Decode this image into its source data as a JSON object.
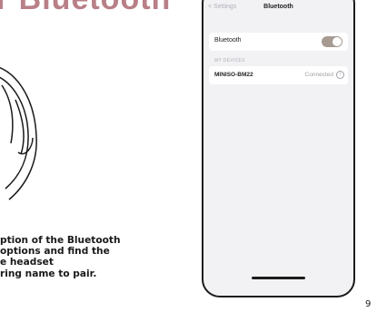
{
  "manual": {
    "heading": "r Bluetooth",
    "instructions": [
      "ption of the Bluetooth",
      "options and find the",
      "e headset",
      "ring name to pair."
    ],
    "page_number": "9"
  },
  "phone": {
    "navbar": {
      "back_label": "< Settings",
      "title": "Bluetooth"
    },
    "bluetooth_row": {
      "label": "Bluetooth",
      "toggle_on": true
    },
    "section_header": "MY DEVICES",
    "device": {
      "name": "MINISO-BM22",
      "status": "Connected",
      "info_glyph": "i"
    }
  },
  "colors": {
    "heading": "#b97f87",
    "toggle_on": "#a79a93"
  },
  "icons": {
    "info": "info-icon",
    "back": "chevron-left-icon"
  }
}
